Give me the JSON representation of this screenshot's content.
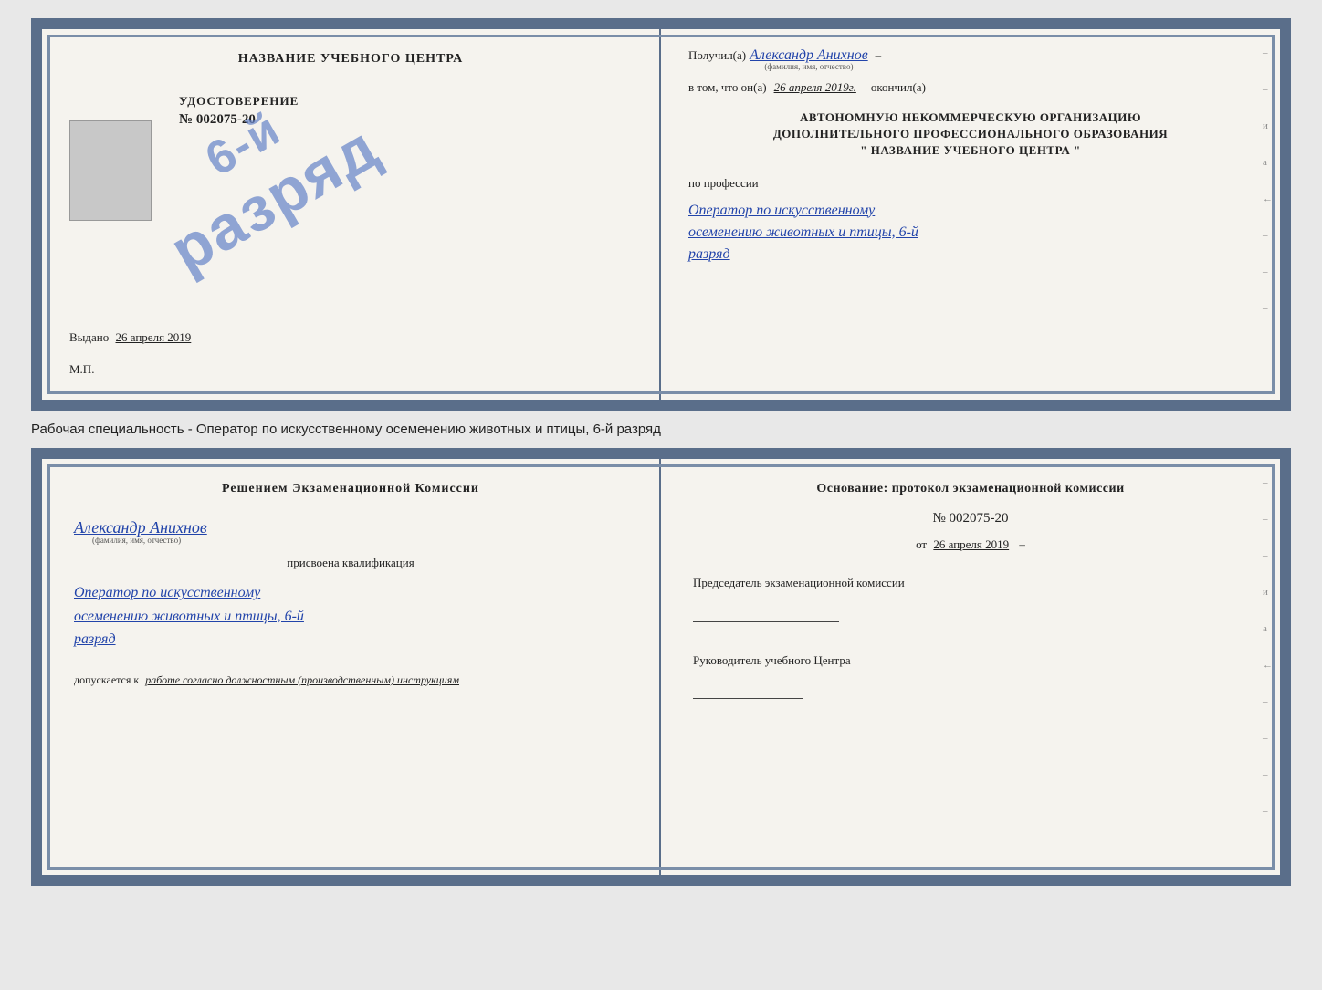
{
  "topDoc": {
    "left": {
      "header": "НАЗВАНИЕ УЧЕБНОГО ЦЕНТРА",
      "photo_alt": "Фото",
      "cert_title": "УДОСТОВЕРЕНИЕ",
      "cert_number": "№ 002075-20",
      "issued_label": "Выдано",
      "issued_date": "26 апреля 2019",
      "mp": "М.П."
    },
    "stamp": {
      "line1": "6-й",
      "line2": "разряд"
    },
    "right": {
      "received_label": "Получил(а)",
      "received_name": "Александр Анихнов",
      "name_subtitle": "(фамилия, имя, отчество)",
      "dash": "–",
      "date_label": "в том, что он(а)",
      "date_value": "26 апреля 2019г.",
      "finished_label": "окончил(а)",
      "org_line1": "АВТОНОМНУЮ НЕКОММЕРЧЕСКУЮ ОРГАНИЗАЦИЮ",
      "org_line2": "ДОПОЛНИТЕЛЬНОГО ПРОФЕССИОНАЛЬНОГО ОБРАЗОВАНИЯ",
      "org_line3": "\" НАЗВАНИЕ УЧЕБНОГО ЦЕНТРА \"",
      "profession_label": "по профессии",
      "profession_text_line1": "Оператор по искусственному",
      "profession_text_line2": "осеменению животных и птицы, 6-й",
      "profession_text_line3": "разряд"
    },
    "right_marks": [
      "–",
      "–",
      "и",
      "а",
      "←",
      "–",
      "–",
      "–"
    ]
  },
  "subtitle": "Рабочая специальность - Оператор по искусственному осеменению животных и птицы, 6-й разряд",
  "bottomDoc": {
    "left": {
      "decision_text": "Решением экзаменационной комиссии",
      "person_name": "Александр Анихнов",
      "name_subtitle": "(фамилия, имя, отчество)",
      "assigned_text": "присвоена квалификация",
      "qualification_line1": "Оператор по искусственному",
      "qualification_line2": "осеменению животных и птицы, 6-й",
      "qualification_line3": "разряд",
      "allowed_label": "допускается к",
      "allowed_text": "работе согласно должностным (производственным) инструкциям"
    },
    "right": {
      "basis_text": "Основание: протокол экзаменационной комиссии",
      "protocol_number": "№  002075-20",
      "protocol_date_prefix": "от",
      "protocol_date": "26 апреля 2019",
      "chairman_text": "Председатель экзаменационной комиссии",
      "head_label": "Руководитель учебного Центра",
      "marks": [
        "–",
        "–",
        "–",
        "и",
        "а",
        "←",
        "–",
        "–",
        "–",
        "–"
      ]
    }
  }
}
